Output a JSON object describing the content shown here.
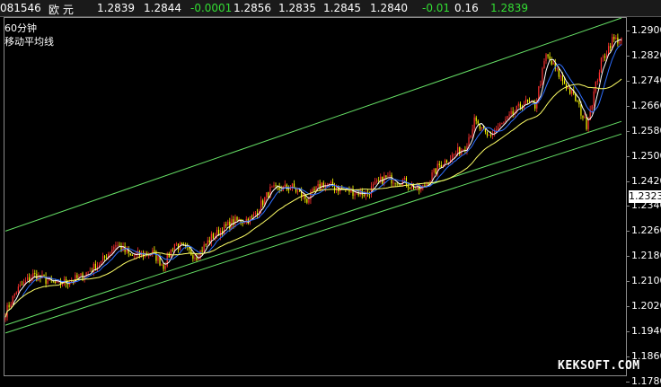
{
  "quote_bar": {
    "code": "081546",
    "name": "欧 元",
    "open": "1.2839",
    "high": "1.2844",
    "change": "-0.0001",
    "last": "1.2856",
    "low": "1.2835",
    "bid": "1.2845",
    "ask": "1.2840",
    "change2": "-0.01",
    "vol": "0.16",
    "current": "1.2839"
  },
  "overlay": {
    "period": "60分钟",
    "indicator": "移动平均线"
  },
  "price_tag": "1.2323",
  "watermark": "KEKSOFT.COM",
  "colors": {
    "up": "#ff3030",
    "down": "#ffff00",
    "ma_short": "#ffffff",
    "ma_mid": "#2e6eff",
    "ma_long": "#ffff66",
    "trend_line": "#66e066",
    "axis_text": "#ffffff",
    "positive_text": "#33dd33"
  },
  "chart_data": {
    "type": "line",
    "title": "",
    "xlabel": "",
    "ylabel": "",
    "ylim": [
      1.18,
      1.294
    ],
    "y_ticks": [
      "1.2900",
      "1.2820",
      "1.2740",
      "1.2660",
      "1.2580",
      "1.2500",
      "1.2420",
      "1.2340",
      "1.2260",
      "1.2180",
      "1.2100",
      "1.2020",
      "1.1940",
      "1.1860",
      "1.1780"
    ],
    "y_tick_values": [
      1.29,
      1.282,
      1.274,
      1.266,
      1.258,
      1.25,
      1.242,
      1.234,
      1.226,
      1.218,
      1.21,
      1.202,
      1.194,
      1.186,
      1.178
    ],
    "x_count": 336,
    "price_anchors": [
      [
        0,
        1.2
      ],
      [
        6,
        1.207
      ],
      [
        15,
        1.212
      ],
      [
        28,
        1.209
      ],
      [
        40,
        1.211
      ],
      [
        52,
        1.216
      ],
      [
        60,
        1.222
      ],
      [
        68,
        1.218
      ],
      [
        80,
        1.219
      ],
      [
        86,
        1.215
      ],
      [
        92,
        1.222
      ],
      [
        98,
        1.22
      ],
      [
        104,
        1.218
      ],
      [
        112,
        1.224
      ],
      [
        124,
        1.229
      ],
      [
        134,
        1.23
      ],
      [
        144,
        1.239
      ],
      [
        156,
        1.24
      ],
      [
        164,
        1.236
      ],
      [
        172,
        1.241
      ],
      [
        186,
        1.239
      ],
      [
        196,
        1.238
      ],
      [
        206,
        1.243
      ],
      [
        216,
        1.242
      ],
      [
        226,
        1.239
      ],
      [
        236,
        1.247
      ],
      [
        250,
        1.253
      ],
      [
        255,
        1.261
      ],
      [
        262,
        1.256
      ],
      [
        272,
        1.261
      ],
      [
        282,
        1.267
      ],
      [
        288,
        1.266
      ],
      [
        294,
        1.282
      ],
      [
        302,
        1.275
      ],
      [
        310,
        1.268
      ],
      [
        316,
        1.26
      ],
      [
        324,
        1.28
      ],
      [
        330,
        1.287
      ],
      [
        335,
        1.287
      ]
    ],
    "trend_channel": {
      "upper": [
        [
          0,
          1.226
        ],
        [
          335,
          1.294
        ]
      ],
      "lower": [
        [
          0,
          1.196
        ],
        [
          335,
          1.261
        ]
      ],
      "lower2": [
        [
          0,
          1.1935
        ],
        [
          335,
          1.257
        ]
      ]
    },
    "moving_averages": [
      {
        "period": 5,
        "color": "#ffffff"
      },
      {
        "period": 10,
        "color": "#2e6eff"
      },
      {
        "period": 30,
        "color": "#ffff66"
      }
    ],
    "grid": false
  }
}
